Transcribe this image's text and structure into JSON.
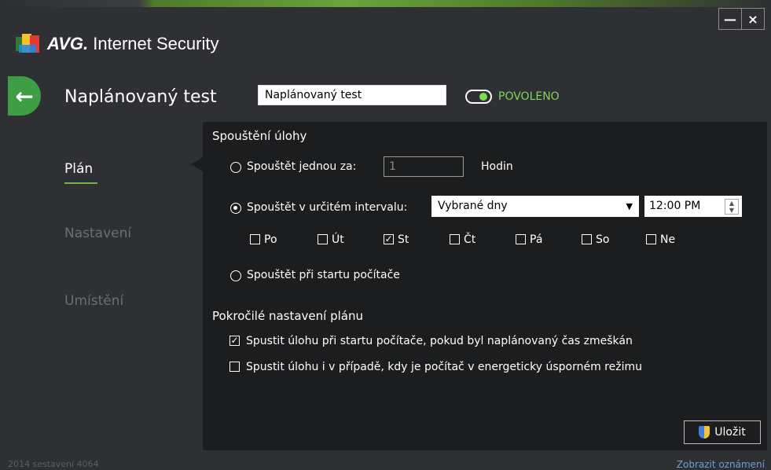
{
  "window": {
    "app_brand": "AVG.",
    "app_name": "Internet Security",
    "minimize": "—",
    "close": "×"
  },
  "header": {
    "back_icon": "arrow-left",
    "title": "Naplánovaný test",
    "name_value": "Naplánovaný test",
    "status": "POVOLENO",
    "status_color": "#7ed957"
  },
  "nav": [
    {
      "label": "Plán",
      "active": true
    },
    {
      "label": "Nastavení",
      "active": false
    },
    {
      "label": "Umístění",
      "active": false
    }
  ],
  "run_section": {
    "title": "Spouštění úlohy",
    "once_label": "Spouštět jednou za:",
    "once_value": "1",
    "once_unit": "Hodin",
    "interval_label": "Spouštět v určitém intervalu:",
    "interval_select": "Vybrané dny",
    "time_value": "12:00 PM",
    "days": [
      {
        "label": "Po",
        "checked": false
      },
      {
        "label": "Út",
        "checked": false
      },
      {
        "label": "St",
        "checked": true
      },
      {
        "label": "Čt",
        "checked": false
      },
      {
        "label": "Pá",
        "checked": false
      },
      {
        "label": "So",
        "checked": false
      },
      {
        "label": "Ne",
        "checked": false
      }
    ],
    "startup_label": "Spouštět při startu počítače"
  },
  "advanced_section": {
    "title": "Pokročilé nastavení plánu",
    "opt1": "Spustit úlohu při startu počítače, pokud byl naplánovaný čas zmeškán",
    "opt1_checked": true,
    "opt2": "Spustit úlohu i v případě, kdy je počítač v energeticky úsporném režimu",
    "opt2_checked": false
  },
  "save_label": "Uložit",
  "footer": {
    "build": "2014 sestavení 4064",
    "notifications": "Zobrazit oznámení"
  }
}
